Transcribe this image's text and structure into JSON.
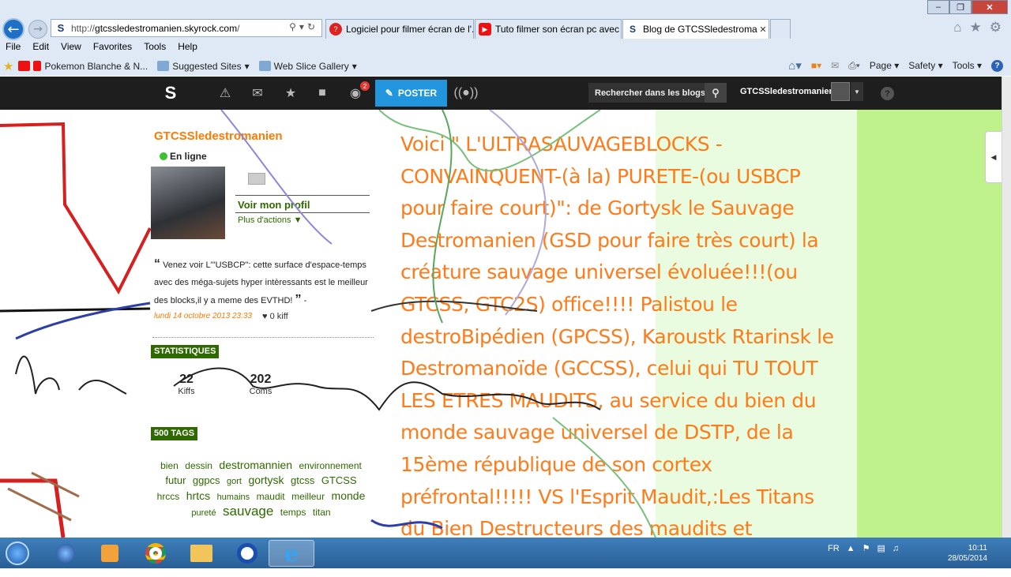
{
  "browser": {
    "address": {
      "prefix": "http://",
      "domain": "gtcssledestromanien.skyrock.com",
      "suffix": "/"
    },
    "tabs": [
      {
        "label": "Logiciel pour filmer écran de l'..."
      },
      {
        "label": "Tuto filmer son écran pc avec ..."
      },
      {
        "label": "Blog de GTCSSledestroman..."
      }
    ],
    "menu": [
      "File",
      "Edit",
      "View",
      "Favorites",
      "Tools",
      "Help"
    ],
    "favorites": [
      "Pokemon Blanche & N...",
      "Suggested Sites",
      "Web Slice Gallery"
    ],
    "commands": [
      "Page",
      "Safety",
      "Tools"
    ]
  },
  "skyrock": {
    "notif_count": "2",
    "poster_label": "POSTER",
    "search_label": "Rechercher dans les blogs",
    "username": "GTCSSledestromanien",
    "help": "?"
  },
  "sidebar": {
    "blog_name": "GTCSSledestromanien",
    "status": "En ligne",
    "profile_link": "Voir mon profil",
    "actions_link": "Plus d'actions ▼",
    "quote": "Venez voir L'\"USBCP\": cette surface d'espace-temps avec des méga-sujets hyper intèressants est le meilleur des blocks,il y a meme des EVTHD!",
    "quote_date": "lundi 14 octobre 2013 23:33",
    "kiff_count": "0 kiff",
    "stats_label": "STATISTIQUES",
    "kiffs": {
      "value": "22",
      "label": "Kiffs"
    },
    "coms": {
      "value": "202",
      "label": "Coms"
    },
    "tags_label": "500 TAGS",
    "tags": [
      {
        "t": "bien",
        "s": 12
      },
      {
        "t": "dessin",
        "s": 12
      },
      {
        "t": "destromannien",
        "s": 14
      },
      {
        "t": "environnement",
        "s": 12
      },
      {
        "t": "futur",
        "s": 13
      },
      {
        "t": "ggpcs",
        "s": 13
      },
      {
        "t": "gort",
        "s": 11
      },
      {
        "t": "gortysk",
        "s": 14
      },
      {
        "t": "gtcss",
        "s": 13
      },
      {
        "t": "GTCSS",
        "s": 13
      },
      {
        "t": "hrccs",
        "s": 12
      },
      {
        "t": "hrtcs",
        "s": 14
      },
      {
        "t": "humains",
        "s": 11
      },
      {
        "t": "maudit",
        "s": 12
      },
      {
        "t": "meilleur",
        "s": 12
      },
      {
        "t": "monde",
        "s": 14
      },
      {
        "t": "pureté",
        "s": 11
      },
      {
        "t": "sauvage",
        "s": 17
      },
      {
        "t": "temps",
        "s": 12
      },
      {
        "t": "titan",
        "s": 12
      }
    ]
  },
  "post": {
    "text": "Voici \" L'ULTRASAUVAGEBLOCKS -CONVAINQUENT-(à la) PURETE-(ou USBCP pour faire court)\": de Gortysk le Sauvage Destromanien (GSD pour faire très court) la créature sauvage universel évoluée!!!(ou GTCSS, GTC2S) office!!!! Palistou le destroBipédien (GPCSS), Karoustk Rtarinsk le Destromanoïde (GCCSS), celui qui TU TOUT LES ETRES MAUDITS, au service du bien du monde sauvage universel de DSTP, de la 15ème république de son cortex préfrontal!!!!! VS l'Esprit Maudit,:Les Titans du Bien Destructeurs des maudits et Sauveurs du"
  },
  "taskbar": {
    "lang": "FR",
    "time": "10:11",
    "date": "28/05/2014"
  },
  "colors": {
    "accent_orange": "#ff7a00",
    "green_label": "#2f6a00",
    "poster_blue": "#2196dc",
    "right_green": "#bff28c"
  }
}
